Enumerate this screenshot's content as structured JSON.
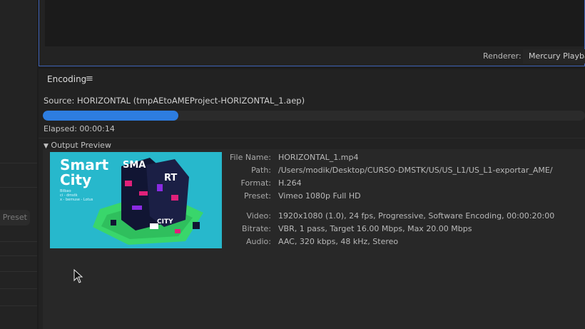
{
  "renderer": {
    "label": "Renderer:",
    "value": "Mercury Playback Engine"
  },
  "left_panel": {
    "preset_label": "Preset"
  },
  "encoding": {
    "title": "Encoding",
    "menu_icon": "hamburger-menu-icon",
    "source": "Source: HORIZONTAL (tmpAEtoAMEProject-HORIZONTAL_1.aep)",
    "progress_percent": 25,
    "elapsed": "Elapsed: 00:00:14",
    "output_preview_label": "Output Preview"
  },
  "thumbnail": {
    "title_line1": "Smart",
    "title_line2": "City",
    "subtitle_line1": "Bilbao",
    "subtitle_line2": "ci - dmstk",
    "subtitle_line3": "x - bemuse - Lotus",
    "block_letters": [
      "SMA",
      "RT",
      "CITY"
    ]
  },
  "file_info": {
    "file_name_label": "File Name:",
    "file_name": "HORIZONTAL_1.mp4",
    "path_label": "Path:",
    "path": "/Users/modik/Desktop/CURSO-DMSTK/US/US_L1/US_L1-exportar_AME/",
    "format_label": "Format:",
    "format": "H.264",
    "preset_label": "Preset:",
    "preset": "Vimeo 1080p Full HD",
    "video_label": "Video:",
    "video": "1920x1080 (1.0), 24 fps, Progressive, Software Encoding, 00:00:20:00",
    "bitrate_label": "Bitrate:",
    "bitrate": "VBR, 1 pass, Target 16.00 Mbps, Max 20.00 Mbps",
    "audio_label": "Audio:",
    "audio": "AAC, 320 kbps, 48 kHz, Stereo"
  },
  "colors": {
    "accent": "#2d7de0",
    "panel_border": "#3f63b8",
    "thumbnail_bg": "#27b8cc"
  }
}
